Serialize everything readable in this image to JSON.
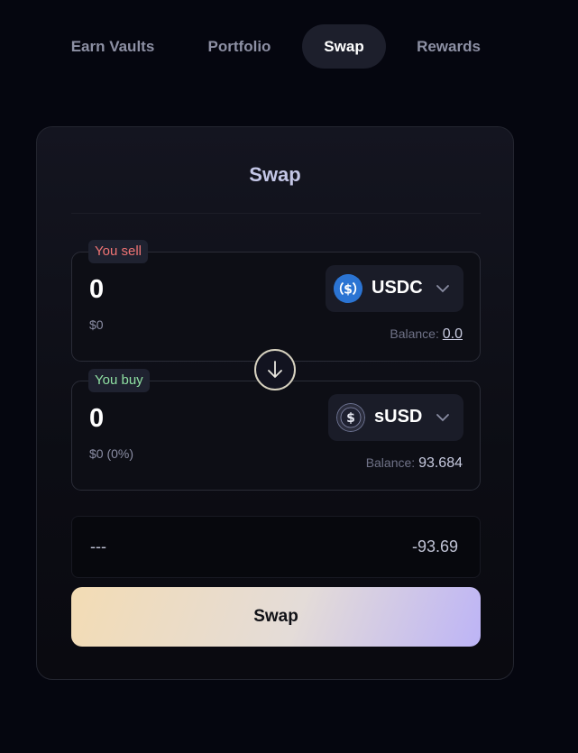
{
  "nav": {
    "tabs": [
      {
        "label": "Earn Vaults",
        "active": false
      },
      {
        "label": "Portfolio",
        "active": false
      },
      {
        "label": "Swap",
        "active": true
      },
      {
        "label": "Rewards",
        "active": false
      }
    ]
  },
  "swap_card": {
    "title": "Swap",
    "sell": {
      "tag": "You sell",
      "amount": "0",
      "usd_value": "$0",
      "token": "USDC",
      "token_icon": "usdc-icon",
      "balance_label": "Balance:",
      "balance_value": "0.0"
    },
    "buy": {
      "tag": "You buy",
      "amount": "0",
      "usd_value": "$0 (0%)",
      "token": "sUSD",
      "token_icon": "susd-icon",
      "balance_label": "Balance:",
      "balance_value": "93.684"
    },
    "switch_icon": "arrow-down-icon",
    "rate": {
      "left": "---",
      "right": "-93.69"
    },
    "submit_label": "Swap"
  },
  "colors": {
    "background": "#05060f",
    "sell_tag": "#f07474",
    "buy_tag": "#8fe0a2",
    "usdc_blue": "#2b74d3"
  }
}
